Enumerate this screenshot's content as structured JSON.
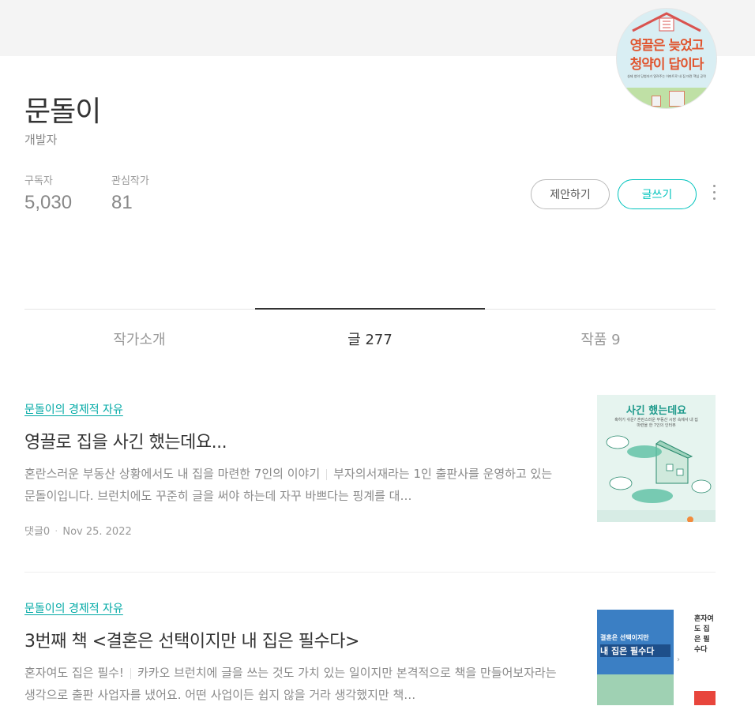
{
  "profile": {
    "name": "문돌이",
    "job": "개발자",
    "subscribers_label": "구독자",
    "subscribers_value": "5,030",
    "following_label": "관심작가",
    "following_value": "81",
    "avatar": {
      "line1": "영끌은 늦었고",
      "line2": "청약이 답이다",
      "sub": "실제 청약 당첨자가 알려주는 아파트로 내 집 마련 핵심 공략"
    }
  },
  "actions": {
    "suggest_label": "제안하기",
    "write_label": "글쓰기"
  },
  "tabs": [
    {
      "label": "작가소개",
      "active": false
    },
    {
      "label": "글 277",
      "active": true
    },
    {
      "label": "작품 9",
      "active": false
    }
  ],
  "posts": [
    {
      "category": "문돌이의 경제적 자유",
      "title": "영끌로 집을 사긴 했는데요...",
      "excerpt_a": "혼란스러운 부동산 상황에서도 내 집을 마련한 7인의 이야기",
      "excerpt_b": "부자의서재라는 1인 출판사를 운영하고 있는 문돌이입니다. 브런치에도 꾸준히 글을 써야 하는데 자꾸 바쁘다는 핑계를 대…",
      "comments": "댓글0",
      "date": "Nov 25. 2022",
      "thumb": {
        "title": "사긴 했는데요",
        "caption": "혹하기 쉬운? 혼란스러운 부동산 시장 속에서 내 집 마련을 한 7인의 인터뷰"
      }
    },
    {
      "category": "문돌이의 경제적 자유",
      "title": "3번째 책 <결혼은 선택이지만 내 집은 필수다>",
      "excerpt_a": "혼자여도 집은 필수!",
      "excerpt_b": "카카오 브런치에 글을 쓰는 것도 가치 있는 일이지만 본격적으로 책을 만들어보자라는 생각으로 출판 사업자를 냈어요. 어떤 사업이든 쉽지 않을 거라 생각했지만 책…",
      "thumb": {
        "cover_a": "결혼은 선택이지만",
        "cover_b": "내 집은 필수다",
        "side": "혼자여도 집은 필수다"
      }
    }
  ],
  "colors": {
    "accent": "#00c3bd",
    "category": "#00a9a5",
    "avatar_text": "#e0552f"
  }
}
